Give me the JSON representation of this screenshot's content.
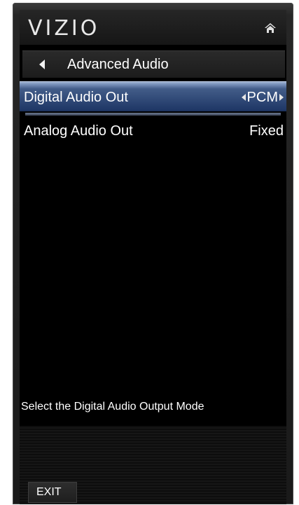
{
  "header": {
    "brand": "VIZIO",
    "home_icon": "home-icon"
  },
  "breadcrumb": {
    "back_icon": "back-arrow-icon",
    "title": "Advanced Audio"
  },
  "menu": {
    "items": [
      {
        "label": "Digital Audio Out",
        "value": "PCM",
        "selected": true
      },
      {
        "label": "Analog Audio Out",
        "value": "Fixed",
        "selected": false
      }
    ]
  },
  "help": {
    "text": "Select the Digital Audio Output Mode"
  },
  "footer": {
    "exit_label": "EXIT"
  },
  "colors": {
    "selection_highlight": "#425c88",
    "background": "#000000",
    "text": "#ffffff"
  }
}
